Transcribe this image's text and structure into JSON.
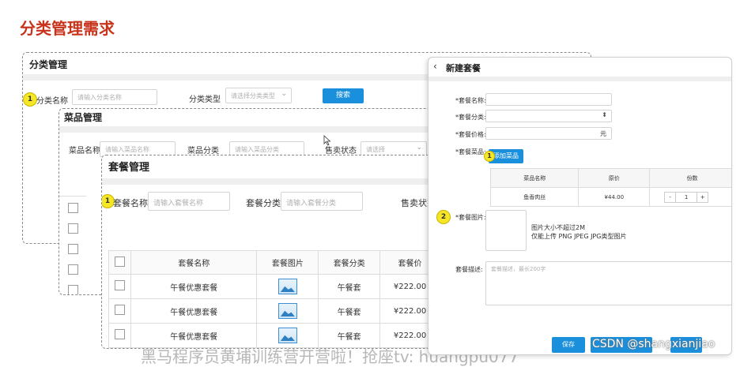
{
  "slide": {
    "title": "分类管理需求"
  },
  "category_panel": {
    "title": "分类管理",
    "name_label": "分类名称",
    "name_placeholder": "请输入分类名称",
    "type_label": "分类类型",
    "type_placeholder": "请选择分类类型",
    "search_label": "搜索",
    "badge": "1"
  },
  "dish_panel": {
    "title": "菜品管理",
    "name_label": "菜品名称",
    "name_placeholder": "请输入菜品名称",
    "category_label": "菜品分类",
    "category_placeholder": "请输入菜品分类",
    "status_label": "售卖状态",
    "status_placeholder": "请选择",
    "badge": "1"
  },
  "setmeal_panel": {
    "title": "套餐管理",
    "name_label": "套餐名称",
    "name_placeholder": "请输入套餐名称",
    "category_label": "套餐分类",
    "category_placeholder": "请输入套餐分类",
    "status_label": "售卖状态",
    "badge": "1",
    "columns": [
      "套餐名称",
      "套餐图片",
      "套餐分类",
      "套餐价"
    ],
    "rows": [
      {
        "name": "午餐优惠套餐",
        "category": "午餐套",
        "price": "¥222.00"
      },
      {
        "name": "午餐优惠套餐",
        "category": "午餐套",
        "price": "¥222.00"
      },
      {
        "name": "午餐优惠套餐",
        "category": "午餐套",
        "price": "¥222.00"
      }
    ]
  },
  "new_setmeal": {
    "back_icon": "chevron-left-icon",
    "title": "新建套餐",
    "name_label": "*套餐名称:",
    "category_label": "*套餐分类:",
    "price_label": "*套餐价格:",
    "price_unit": "元",
    "dishes_label": "*套餐菜品:",
    "add_dish_label": "添加菜品",
    "dish_columns": [
      "菜品名称",
      "原价",
      "份数"
    ],
    "dish_rows": [
      {
        "name": "鱼香肉丝",
        "price": "¥44.00",
        "qty": "1",
        "minus": "-",
        "plus": "+"
      }
    ],
    "image_label": "*套餐图片:",
    "image_hint_1": "图片大小不超过2M",
    "image_hint_2": "仅能上传 PNG JPEG JPG类型图片",
    "desc_label": "套餐描述:",
    "desc_placeholder": "套餐描述，最长200字",
    "save_label": "保存",
    "badge_1": "1",
    "badge_2": "2"
  },
  "footer": {
    "text": "黑马程序员黄埔训练营开营啦！抢座tv: huangpu077",
    "watermark": "CSDN @shangxianjiao"
  },
  "colors": {
    "title_red": "#c8331c",
    "accent_blue": "#1a8fdc",
    "badge_yellow": "#f5e626"
  }
}
